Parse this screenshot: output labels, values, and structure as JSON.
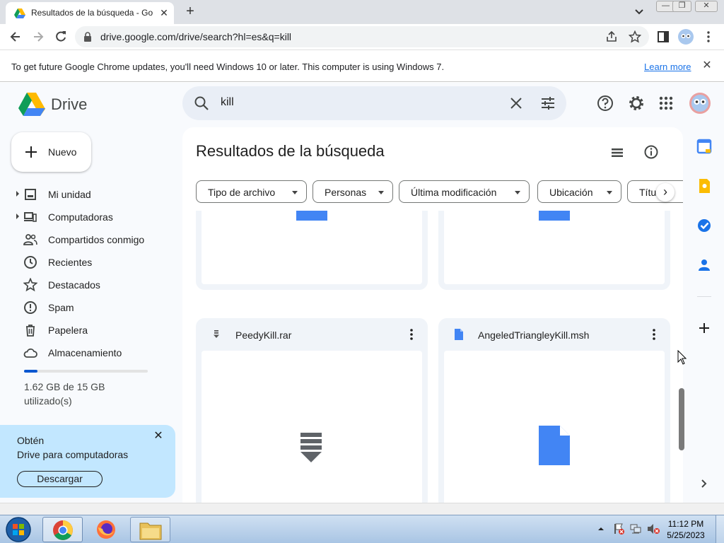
{
  "browser": {
    "tab_title": "Resultados de la búsqueda - Goo",
    "url": "drive.google.com/drive/search?hl=es&q=kill"
  },
  "infobar": {
    "message": "To get future Google Chrome updates, you'll need Windows 10 or later. This computer is using Windows 7.",
    "link": "Learn more"
  },
  "drive": {
    "logo_text": "Drive",
    "search_value": "kill",
    "new_button": "Nuevo",
    "nav": [
      {
        "label": "Mi unidad"
      },
      {
        "label": "Computadoras"
      },
      {
        "label": "Compartidos conmigo"
      },
      {
        "label": "Recientes"
      },
      {
        "label": "Destacados"
      },
      {
        "label": "Spam"
      },
      {
        "label": "Papelera"
      },
      {
        "label": "Almacenamiento"
      }
    ],
    "storage": {
      "text": "1.62 GB de 15 GB utilizado(s)",
      "used_fraction": 0.108
    },
    "promo": {
      "line1": "Obtén",
      "line2": "Drive para computadoras",
      "button": "Descargar"
    },
    "results_title": "Resultados de la búsqueda",
    "filters": [
      "Tipo de archivo",
      "Personas",
      "Última modificación",
      "Ubicación",
      "Títu"
    ],
    "files": [
      {
        "name": "PeedyKill.rar",
        "type": "archive"
      },
      {
        "name": "AngeledTriangleyKill.msh",
        "type": "document"
      }
    ]
  },
  "taskbar": {
    "time": "11:12 PM",
    "date": "5/25/2023"
  },
  "colors": {
    "accent": "#0b57d0",
    "promo_bg": "#c2e7ff",
    "doc_blue": "#4285f4"
  }
}
